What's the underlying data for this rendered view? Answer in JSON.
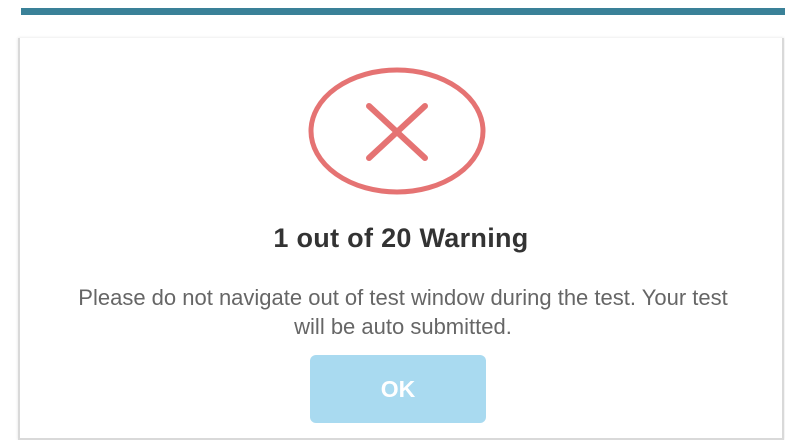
{
  "top_bar": {
    "color": "#3a8198"
  },
  "dialog": {
    "icon": "error-x-circle-icon",
    "icon_color": "#e57373",
    "title": "1 out of 20 Warning",
    "message": "Please do not navigate out of test window during the test. Your test will be auto submitted.",
    "ok_label": "OK",
    "ok_button_color": "#a9daf0"
  }
}
